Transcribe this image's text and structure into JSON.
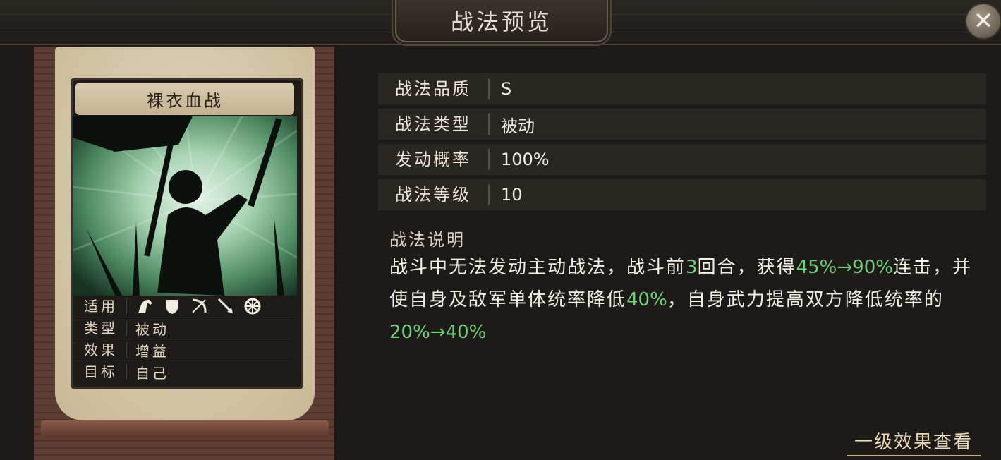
{
  "header": {
    "title": "战法预览",
    "close_icon": "close-icon"
  },
  "card": {
    "name": "裸衣血战",
    "info": [
      {
        "key": "适用",
        "value": "",
        "icons": [
          "cavalry-icon",
          "shield-icon",
          "bow-icon",
          "spear-icon",
          "wheel-icon"
        ]
      },
      {
        "key": "类型",
        "value": "被动"
      },
      {
        "key": "效果",
        "value": "增益"
      },
      {
        "key": "目标",
        "value": "自己"
      }
    ]
  },
  "details": [
    {
      "key": "战法品质",
      "value": "S"
    },
    {
      "key": "战法类型",
      "value": "被动"
    },
    {
      "key": "发动概率",
      "value": "100%"
    },
    {
      "key": "战法等级",
      "value": "10"
    }
  ],
  "description": {
    "heading": "战法说明",
    "segments": [
      {
        "text": "战斗中无法发动主动战法，战斗前",
        "highlight": false
      },
      {
        "text": "3",
        "highlight": true
      },
      {
        "text": "回合，获得",
        "highlight": false
      },
      {
        "text": "45%→90%",
        "highlight": true
      },
      {
        "text": "连击，并使自身及敌军单体统率降低",
        "highlight": false
      },
      {
        "text": "40%",
        "highlight": true
      },
      {
        "text": "，自身武力提高双方降低统率的",
        "highlight": false
      },
      {
        "text": "20%→40%",
        "highlight": true
      }
    ]
  },
  "footer": {
    "link_label": "一级效果查看"
  },
  "colors": {
    "highlight": "#6fcf7e",
    "panel": "#2a2622",
    "background": "#1d1a17"
  }
}
